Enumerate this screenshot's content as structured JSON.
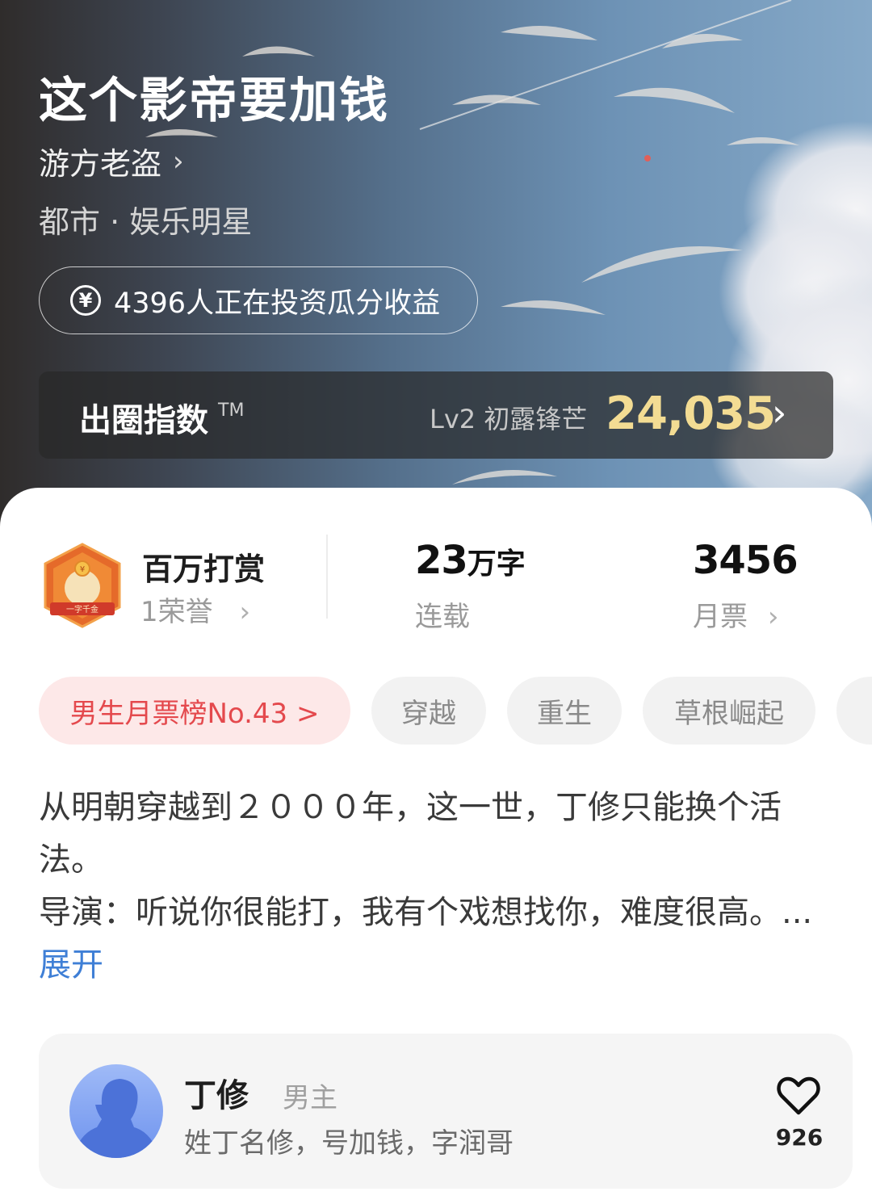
{
  "book": {
    "title": "这个影帝要加钱",
    "author": "游方老盗",
    "author_chevron": "›",
    "genre": "都市 · 娱乐明星"
  },
  "invest": {
    "icon": "yen-circle-icon",
    "icon_glyph": "¥",
    "text": "4396人正在投资瓜分收益"
  },
  "index_bar": {
    "label": "出圈指数",
    "tm": "TM",
    "level": "Lv2 初露锋芒",
    "value": "24,035",
    "chevron": "›",
    "value_color": "#f3dc93"
  },
  "stats": {
    "reward": {
      "title": "百万打赏",
      "sub": "1荣誉",
      "chevron": "›",
      "badge_text": "一字千金"
    },
    "words": {
      "number": "23",
      "unit": "万字",
      "label": "连载"
    },
    "votes": {
      "number": "3456",
      "label": "月票",
      "chevron": "›"
    }
  },
  "tags": [
    {
      "label": "男生月票榜No.43 >",
      "kind": "rank"
    },
    {
      "label": "穿越",
      "kind": "normal"
    },
    {
      "label": "重生",
      "kind": "normal"
    },
    {
      "label": "草根崛起",
      "kind": "normal"
    },
    {
      "label": "",
      "kind": "normal"
    }
  ],
  "synopsis": {
    "para1": "从明朝穿越到２０００年，这一世，丁修只能换个活法。",
    "para2": "导演：听说你很能打，我有个戏想找你，难度很高。...",
    "expand": "展开"
  },
  "character": {
    "name": "丁修",
    "role": "男主",
    "desc": "姓丁名修，号加钱，字润哥",
    "likes": "926",
    "icon": "heart-icon"
  },
  "colors": {
    "accent_red": "#e4494d",
    "link_blue": "#3f7fd6",
    "gold": "#f3dc93"
  }
}
